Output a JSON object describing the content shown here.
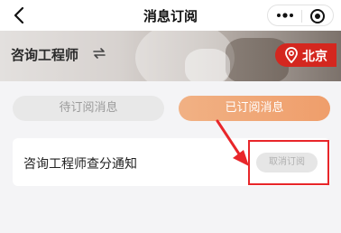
{
  "navbar": {
    "title": "消息订阅"
  },
  "banner": {
    "title": "咨询工程师",
    "city": "北京"
  },
  "tabs": [
    {
      "label": "待订阅消息",
      "active": false
    },
    {
      "label": "已订阅消息",
      "active": true
    }
  ],
  "subscription": {
    "title": "咨询工程师查分通知",
    "action_label": "取消订阅"
  },
  "colors": {
    "accent": "#ef9e6b",
    "city_red": "#d4271f",
    "annotation_red": "#e8262a"
  }
}
